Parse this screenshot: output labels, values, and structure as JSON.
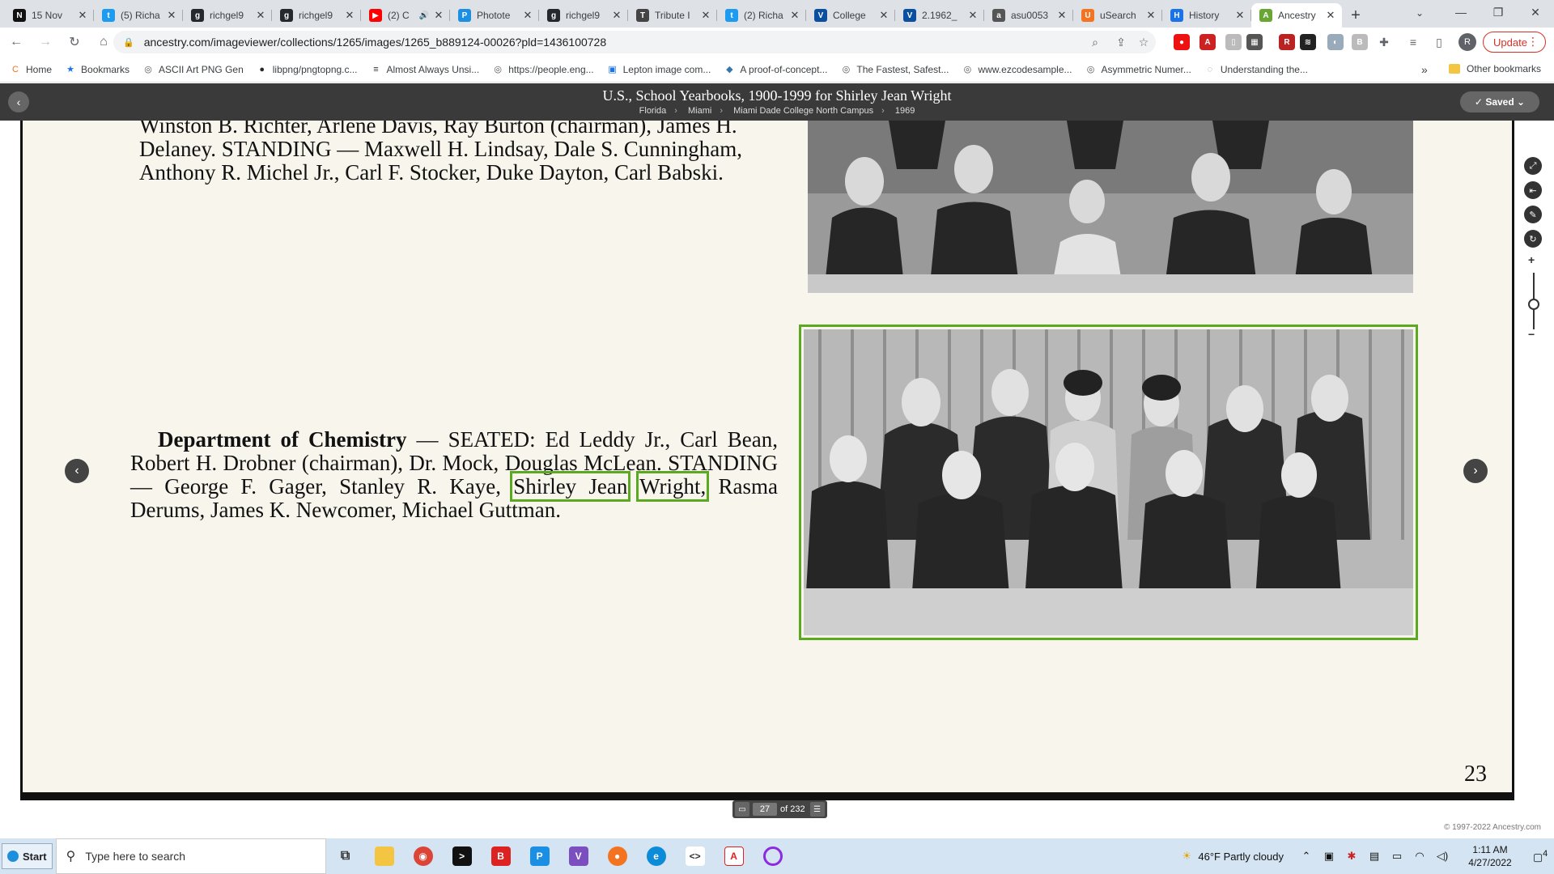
{
  "tabs": [
    {
      "title": "15 Nov",
      "fav": "N",
      "color": "#111111"
    },
    {
      "title": "(5) Richa",
      "fav": "t",
      "color": "#1d9bf0"
    },
    {
      "title": "richgel9",
      "fav": "g",
      "color": "#24292f"
    },
    {
      "title": "richgel9",
      "fav": "g",
      "color": "#24292f"
    },
    {
      "title": "(2) C",
      "fav": "▶",
      "color": "#ff0000"
    },
    {
      "title": "Photote",
      "fav": "P",
      "color": "#1a8fe3"
    },
    {
      "title": "richgel9",
      "fav": "g",
      "color": "#24292f"
    },
    {
      "title": "Tribute I",
      "fav": "T",
      "color": "#444444"
    },
    {
      "title": "(2) Richa",
      "fav": "t",
      "color": "#1d9bf0"
    },
    {
      "title": "College",
      "fav": "V",
      "color": "#0b4fa0"
    },
    {
      "title": "2.1962_",
      "fav": "V",
      "color": "#0b4fa0"
    },
    {
      "title": "asu0053",
      "fav": "a",
      "color": "#555555"
    },
    {
      "title": "uSearch",
      "fav": "U",
      "color": "#f47321"
    },
    {
      "title": "History",
      "fav": "H",
      "color": "#1a73e8"
    },
    {
      "title": "Ancestry",
      "fav": "A",
      "color": "#6aa633"
    }
  ],
  "address": {
    "url": "ancestry.com/imageviewer/collections/1265/images/1265_b889124-00026?pld=1436100728",
    "update_label": "Update",
    "avatar": "R"
  },
  "bookmarks": [
    {
      "label": "Home",
      "icon": "C",
      "color": "#f47321"
    },
    {
      "label": "Bookmarks",
      "icon": "★",
      "color": "#1a73e8"
    },
    {
      "label": "ASCII Art PNG Gen",
      "icon": "◎",
      "color": "#555555"
    },
    {
      "label": "libpng/pngtopng.c...",
      "icon": "●",
      "color": "#24292f"
    },
    {
      "label": "Almost Always Unsi...",
      "icon": "≡",
      "color": "#333333"
    },
    {
      "label": "https://people.eng...",
      "icon": "◎",
      "color": "#555555"
    },
    {
      "label": "Lepton image com...",
      "icon": "▣",
      "color": "#1a73e8"
    },
    {
      "label": "A proof-of-concept...",
      "icon": "◆",
      "color": "#3776ab"
    },
    {
      "label": "The Fastest, Safest...",
      "icon": "◎",
      "color": "#555555"
    },
    {
      "label": "www.ezcodesample...",
      "icon": "◎",
      "color": "#555555"
    },
    {
      "label": "Asymmetric Numer...",
      "icon": "◎",
      "color": "#555555"
    },
    {
      "label": "Understanding the...",
      "icon": "◌",
      "color": "#888888"
    }
  ],
  "other_bookmarks": "Other bookmarks",
  "viewer": {
    "title": "U.S., School Yearbooks, 1900-1999 for Shirley Jean Wright",
    "crumbs": [
      "Florida",
      "Miami",
      "Miami Dade College North Campus",
      "1969"
    ],
    "saved_label": "Saved",
    "caption_top": "Winston B. Richter, Arlene Davis, Ray Burton (chairman), James H. Delaney. STANDING — Maxwell H. Lindsay, Dale S. Cunningham, Anthony R. Michel Jr., Carl F. Stocker, Duke Dayton, Carl Babski.",
    "caption_main_before": "Department of Chemistry",
    "caption_main_part1": " — SEATED: Ed Leddy Jr., Carl Bean, Robert H. Drobner (chairman), Dr. Mock, Douglas McLean. STANDING — George F. Gager, Stanley R. Kaye, ",
    "highlight_first": "Shirley Jean",
    "highlight_last": "Wright,",
    "caption_main_part2": " Rasma Derums, James K. Newcomer, Michael Guttman.",
    "page_number": "23",
    "current_image": "27",
    "of_total": "of 232",
    "copyright": "© 1997-2022 Ancestry.com"
  },
  "taskbar": {
    "start": "Start",
    "search_placeholder": "Type here to search",
    "weather": "46°F  Partly cloudy",
    "time": "1:11 AM",
    "date": "4/27/2022",
    "notifications": "4"
  },
  "colors": {
    "highlight": "#5ba821",
    "header_bg": "#3a3a3a",
    "page_bg": "#f8f5ec"
  }
}
